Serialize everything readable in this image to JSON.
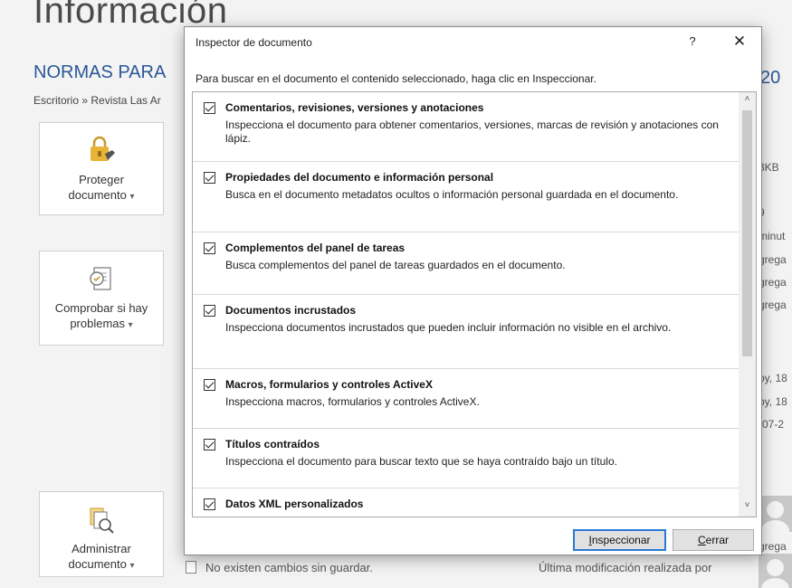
{
  "backstage": {
    "title": "Información",
    "doc_title": "NORMAS PARA",
    "doc_title_suffix": "20",
    "breadcrumb": "Escritorio » Revista Las Ar",
    "protect": {
      "line1": "Proteger",
      "line2": "documento",
      "caret": "▾",
      "icon": "lock-icon"
    },
    "check": {
      "line1": "Comprobar si hay",
      "line2": "problemas",
      "caret": "▾",
      "icon": "inspect-doc-icon"
    },
    "manage": {
      "line1": "Administrar",
      "line2": "documento",
      "caret": "▾",
      "icon": "manage-doc-icon"
    },
    "right_values": [
      "3KB",
      "9",
      "minut",
      "grega",
      "grega",
      "grega",
      "oy, 18",
      "oy, 18",
      "-07-2",
      "grega"
    ],
    "no_changes": "No existen cambios sin guardar.",
    "last_modified": "Última modificación realizada por"
  },
  "dialog": {
    "title": "Inspector de documento",
    "help": "?",
    "close": "✕",
    "instruction": "Para buscar en el documento el contenido seleccionado, haga clic en Inspeccionar.",
    "items": [
      {
        "title": "Comentarios, revisiones, versiones y anotaciones",
        "desc": "Inspecciona el documento para obtener comentarios, versiones, marcas de revisión y anotaciones con lápiz.",
        "checked": true
      },
      {
        "title": "Propiedades del documento e información personal",
        "desc": "Busca en el documento metadatos ocultos o información personal guardada en el documento.",
        "checked": true
      },
      {
        "title": "Complementos del panel de tareas",
        "desc": "Busca complementos del panel de tareas guardados en el documento.",
        "checked": true
      },
      {
        "title": "Documentos incrustados",
        "desc": "Inspecciona documentos incrustados que pueden incluir información no visible en el archivo.",
        "checked": true
      },
      {
        "title": "Macros, formularios y controles ActiveX",
        "desc": "Inspecciona macros, formularios y controles ActiveX.",
        "checked": true
      },
      {
        "title": "Títulos contraídos",
        "desc": "Inspecciona el documento para buscar texto que se haya contraído bajo un título.",
        "checked": true
      },
      {
        "title": "Datos XML personalizados",
        "desc": "",
        "checked": true
      }
    ],
    "inspect_button": "Inspeccionar",
    "close_button": "Cerrar",
    "scroll_up": "˄",
    "scroll_down": "˅"
  }
}
